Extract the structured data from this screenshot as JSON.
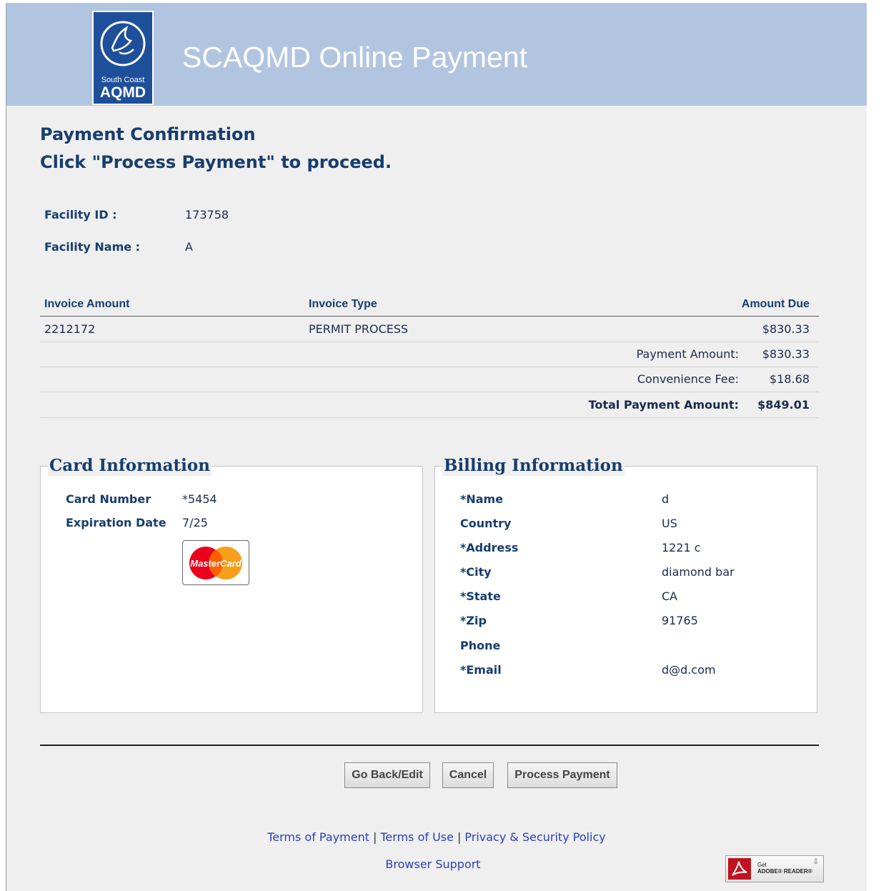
{
  "header": {
    "logo_org": "South Coast",
    "logo_abbr": "AQMD",
    "title": "SCAQMD Online Payment"
  },
  "page": {
    "heading_line1": "Payment Confirmation",
    "heading_line2": "Click \"Process Payment\" to proceed."
  },
  "facility": {
    "id_label": "Facility ID :",
    "id_value": "173758",
    "name_label": "Facility Name :",
    "name_value": "A"
  },
  "invoice": {
    "columns": [
      "Invoice Amount",
      "Invoice Type",
      "Amount Due"
    ],
    "rows": [
      {
        "invoice": "2212172",
        "type": "PERMIT PROCESS",
        "amount_due": "$830.33"
      }
    ],
    "payment_amount_label": "Payment Amount:",
    "payment_amount": "$830.33",
    "convenience_fee_label": "Convenience Fee:",
    "convenience_fee": "$18.68",
    "total_label": "Total Payment Amount:",
    "total": "$849.01"
  },
  "card": {
    "title": "Card Information",
    "number_label": "Card Number",
    "number": "*5454",
    "expiration_label": "Expiration Date",
    "expiration": "7/25",
    "brand_logo_text": "MasterCard"
  },
  "billing": {
    "title": "Billing Information",
    "fields": [
      {
        "label": "*Name",
        "value": "d"
      },
      {
        "label": "Country",
        "value": "US"
      },
      {
        "label": "*Address",
        "value": "1221 c"
      },
      {
        "label": "*City",
        "value": "diamond bar"
      },
      {
        "label": "*State",
        "value": "CA"
      },
      {
        "label": "*Zip",
        "value": "91765"
      },
      {
        "label": "Phone",
        "value": ""
      },
      {
        "label": "*Email",
        "value": "d@d.com"
      }
    ]
  },
  "actions": {
    "back": "Go Back/Edit",
    "cancel": "Cancel",
    "process": "Process Payment"
  },
  "footer": {
    "terms_payment": "Terms of Payment",
    "terms_use": "Terms of Use",
    "privacy": "Privacy & Security Policy",
    "separator": "|",
    "browser_support": "Browser Support",
    "adobe_get": "Get",
    "adobe_reader": "ADOBE® READER®"
  },
  "colors": {
    "header_bg": "#b2c5e0",
    "heading_text": "#173d6e",
    "link": "#2a3fb8",
    "logo_bg": "#1e4f9a"
  }
}
